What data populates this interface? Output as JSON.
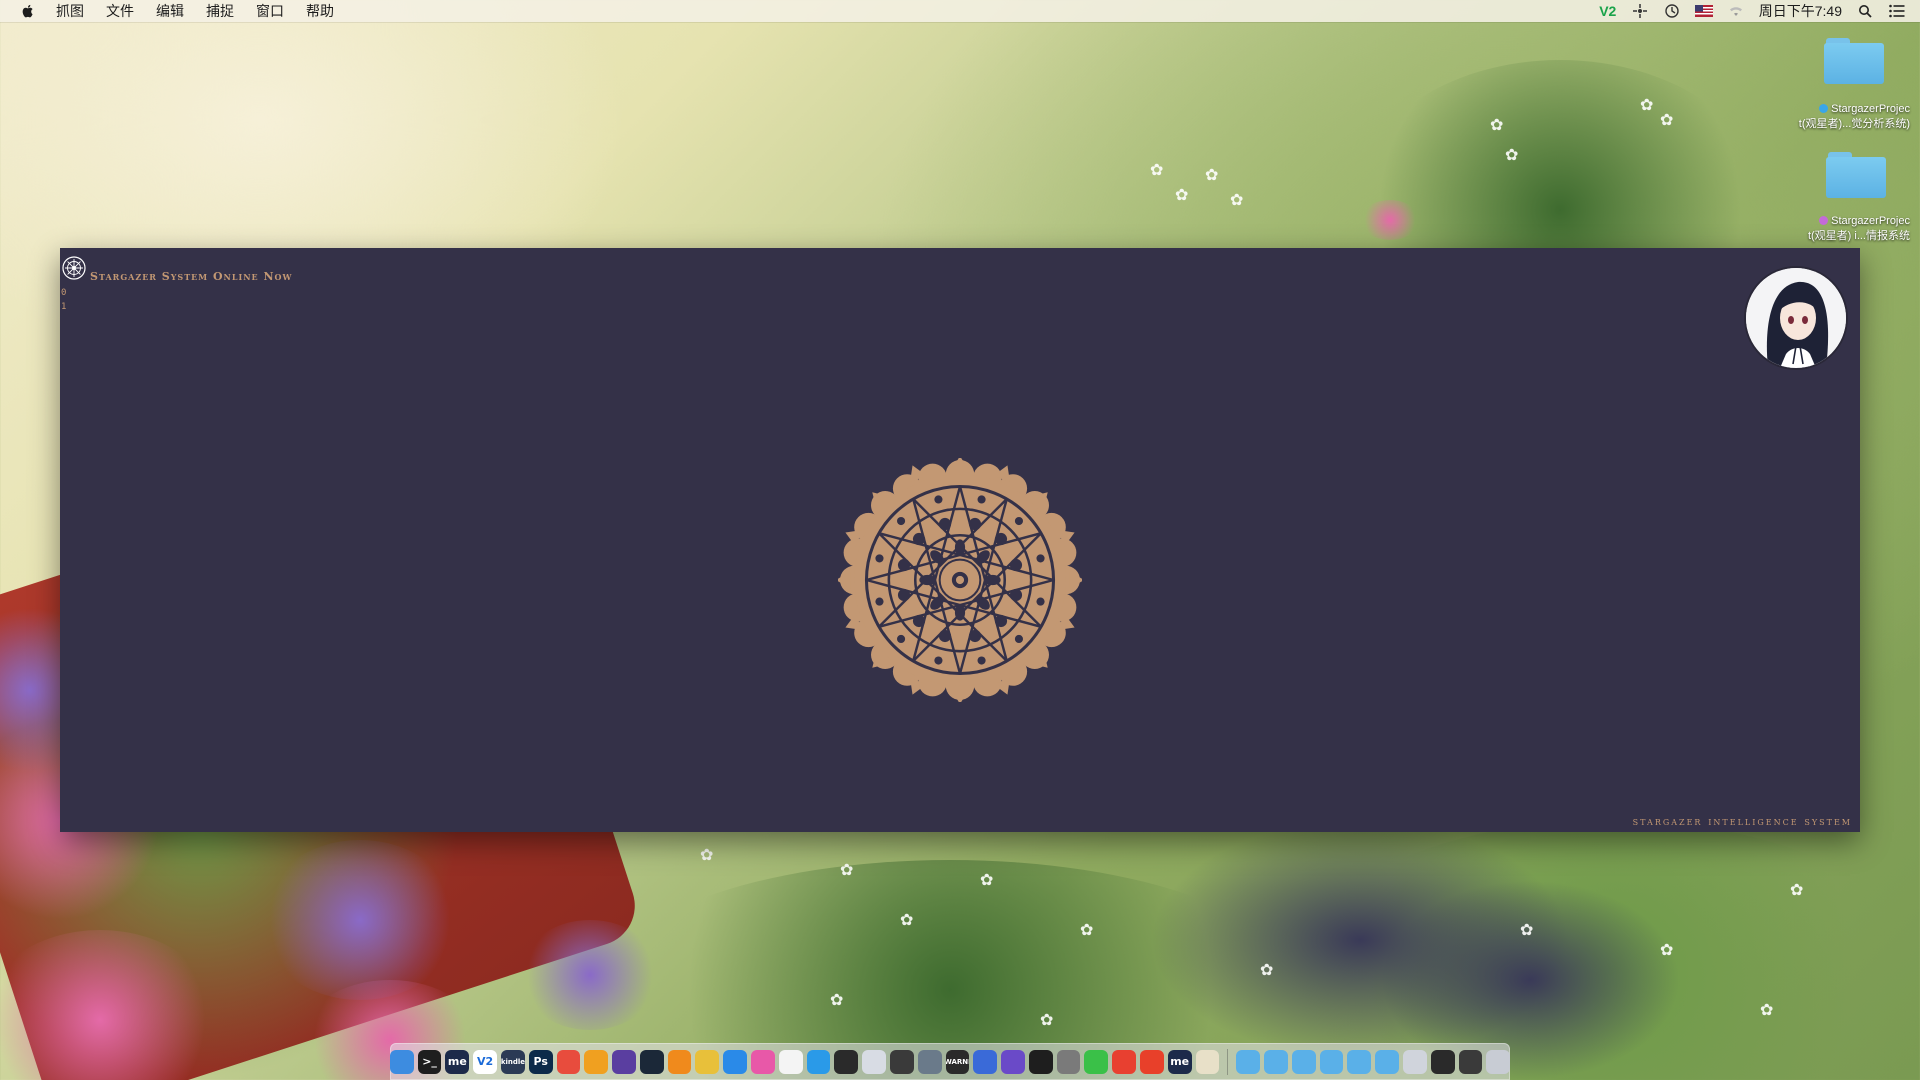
{
  "menubar": {
    "apple_icon": "apple-icon",
    "items": [
      "抓图",
      "文件",
      "编辑",
      "捕捉",
      "窗口",
      "帮助"
    ],
    "status": {
      "vpn_label": "V2",
      "clock": "周日下午7:49"
    }
  },
  "desktop": {
    "folders": [
      {
        "name": "StargazerProject(观星者)...觉分析系统)",
        "line1": "StargazerProjec",
        "line2": "t(观星者)...觉分析系统)",
        "tag_color": "#3aa6e8"
      },
      {
        "name": "StargazerProject(观星者)i...情报系统",
        "line1": "StargazerProjec",
        "line2": "t(观星者) i...情报系统",
        "tag_color": "#c46ad8"
      }
    ]
  },
  "app": {
    "title": "Stargazer System Online Now",
    "line0": "0",
    "line1": "1",
    "footer": "stargazer intelligence system",
    "accent_color": "#c39873",
    "background_color": "#343148"
  },
  "dock": {
    "items": [
      {
        "name": "finder",
        "label": "",
        "color": "#3d8ce0"
      },
      {
        "name": "terminal",
        "label": ">_",
        "color": "#1e1e1e"
      },
      {
        "name": "me-app",
        "label": "me",
        "color": "#1c2a4a"
      },
      {
        "name": "v2ray",
        "label": "V2",
        "color": "#ffffff"
      },
      {
        "name": "kindle",
        "label": "kindle",
        "color": "#2b3a55"
      },
      {
        "name": "photoshop",
        "label": "Ps",
        "color": "#0c2a4a"
      },
      {
        "name": "screenshot",
        "label": "",
        "color": "#e84c3d"
      },
      {
        "name": "sketch",
        "label": "",
        "color": "#f0a020"
      },
      {
        "name": "github",
        "label": "",
        "color": "#5a3ea0"
      },
      {
        "name": "steam",
        "label": "",
        "color": "#1b2838"
      },
      {
        "name": "ibooks",
        "label": "",
        "color": "#f08a1c"
      },
      {
        "name": "chrome",
        "label": "",
        "color": "#e8c03a"
      },
      {
        "name": "safari",
        "label": "",
        "color": "#2a8ae8"
      },
      {
        "name": "itunes",
        "label": "",
        "color": "#e858a8"
      },
      {
        "name": "photos",
        "label": "",
        "color": "#f4f4f4"
      },
      {
        "name": "app-store",
        "label": "",
        "color": "#2a9ae8"
      },
      {
        "name": "vinyl",
        "label": "",
        "color": "#2a2a2a"
      },
      {
        "name": "mail",
        "label": "",
        "color": "#d8dce4"
      },
      {
        "name": "image-viewer",
        "label": "",
        "color": "#3a3a3a"
      },
      {
        "name": "scanner",
        "label": "",
        "color": "#6a7a8a"
      },
      {
        "name": "console",
        "label": "WARNI",
        "color": "#2a2a2a"
      },
      {
        "name": "keynote",
        "label": "",
        "color": "#3a6ad8"
      },
      {
        "name": "xcode",
        "label": "",
        "color": "#6a4ac8"
      },
      {
        "name": "activity-monitor",
        "label": "",
        "color": "#1e1e1e"
      },
      {
        "name": "system-preferences",
        "label": "",
        "color": "#7a7a7a"
      },
      {
        "name": "wechat",
        "label": "",
        "color": "#3ac048"
      },
      {
        "name": "netease-music",
        "label": "",
        "color": "#e84030"
      },
      {
        "name": "weibo",
        "label": "",
        "color": "#e8402a"
      },
      {
        "name": "me-app-2",
        "label": "me",
        "color": "#1c2a4a"
      },
      {
        "name": "preview",
        "label": "",
        "color": "#e8e0c8"
      }
    ],
    "stack_items": [
      {
        "name": "applications-stack",
        "color": "#5ab0e8"
      },
      {
        "name": "documents-stack",
        "color": "#5ab0e8"
      },
      {
        "name": "downloads-stack",
        "color": "#5ab0e8"
      },
      {
        "name": "folder-stack-1",
        "color": "#5ab0e8"
      },
      {
        "name": "folder-stack-2",
        "color": "#5ab0e8"
      },
      {
        "name": "folder-stack-3",
        "color": "#5ab0e8"
      },
      {
        "name": "screenshot-stack",
        "color": "#d0d4dc"
      },
      {
        "name": "terminal-stack",
        "color": "#2a2a2a"
      },
      {
        "name": "console-stack",
        "color": "#3a3a3a"
      },
      {
        "name": "trash",
        "color": "#c8ccd4"
      }
    ]
  }
}
